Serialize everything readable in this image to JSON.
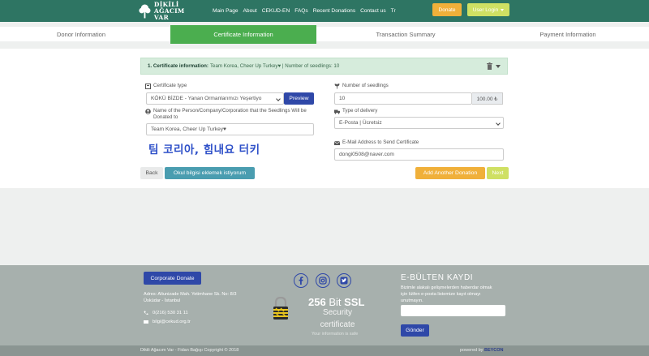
{
  "brand": {
    "line1": "DİKİLİ",
    "line2": "AĞACIM VAR"
  },
  "nav": {
    "links": [
      "Main Page",
      "About",
      "CEKUD-EN",
      "FAQs",
      "Recent Donations",
      "Contact us",
      "Tr"
    ],
    "donate": "Donate",
    "login": "User Login"
  },
  "steps": [
    "Donor Information",
    "Certificate Information",
    "Transaction Summary",
    "Payment Information"
  ],
  "info": {
    "title": "1. Certificate information:",
    "detail": "Team Korea, Cheer Up Turkey♥ | Number of seedlings: 10"
  },
  "form": {
    "cert_type_label": "Certificate type",
    "cert_type_value": "KÖKÜ BİZDE - Yanan Ormanlarımızı Yeşertiyo",
    "preview": "Preview",
    "name_label": "Name of the Person/Company/Corporation that the Seedlings Will be Donated to",
    "name_value": "Team Korea, Cheer Up Turkey♥",
    "preview_text": "팀 코리아, 힘내요 터키",
    "seedlings_label": "Number of seedlings",
    "seedlings_value": "10",
    "seedlings_total": "100.00 ₺",
    "delivery_label": "Type of delivery",
    "delivery_value": "E-Posta | Ücretsiz",
    "email_label": "E-Mail Address to Send Certificate",
    "email_value": "dongi0508@naver.com",
    "back": "Back",
    "school": "Okul bilgisi eklemek istiyorum",
    "add_another": "Add Another Donation",
    "next": "Next"
  },
  "footer": {
    "corporate": "Corporate Donate",
    "address": "Adres: Altunizade Mah. Yetimhane Sk. No: 8/3 Üsküdar - İstanbul",
    "phone": "0(216) 530 31 11",
    "email": "bilgi@cekud.org.tr",
    "ssl_number": "256",
    "ssl_bit": "Bit",
    "ssl_word": "SSL",
    "ssl_line1": "Security",
    "ssl_line2": "certificate",
    "ssl_small": "Your information is safe",
    "news_title": "E-BÜLTEN KAYDI",
    "news_desc": "Bizimle alakalı gelişmelerden haberdar olmak için lütfen e-posta listemize kayıt olmayı unutmayın.",
    "send": "Gönder",
    "copyright": "Dikili Ağacım Var - Fidan Bağışı Copyright © 2018",
    "powered_by": "powered by",
    "powered_brand": "BEYCON"
  },
  "colors": {
    "header": "#2e7563",
    "active_step": "#4bae4f",
    "primary": "#2f48a8",
    "orange": "#f0b03a",
    "lime": "#cfe063",
    "teal": "#4a9db0"
  }
}
